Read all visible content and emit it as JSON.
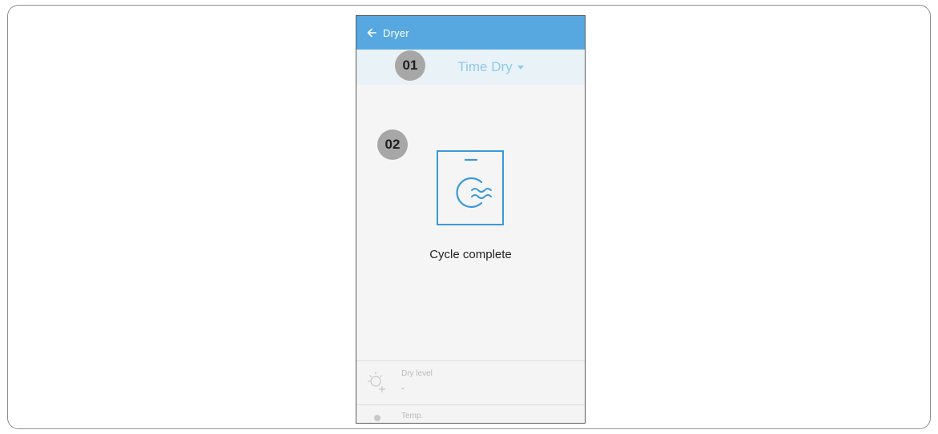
{
  "app": {
    "title": "Dryer",
    "back_icon": "arrow-left-icon"
  },
  "mode": {
    "label": "Time Dry",
    "dropdown_icon": "caret-down-icon"
  },
  "badges": [
    {
      "label": "01"
    },
    {
      "label": "02"
    }
  ],
  "status": {
    "icon": "dryer-drum-icon",
    "text": "Cycle complete"
  },
  "settings": [
    {
      "label": "Dry level",
      "value": "-",
      "icon": "sun-plus-icon"
    },
    {
      "label": "Temp.",
      "icon": "dot-icon"
    }
  ],
  "colors": {
    "appbar": "#57a8e0",
    "accent": "#3a9ad9",
    "mode_text": "#8fcbea",
    "badge": "#a7a7a7"
  }
}
